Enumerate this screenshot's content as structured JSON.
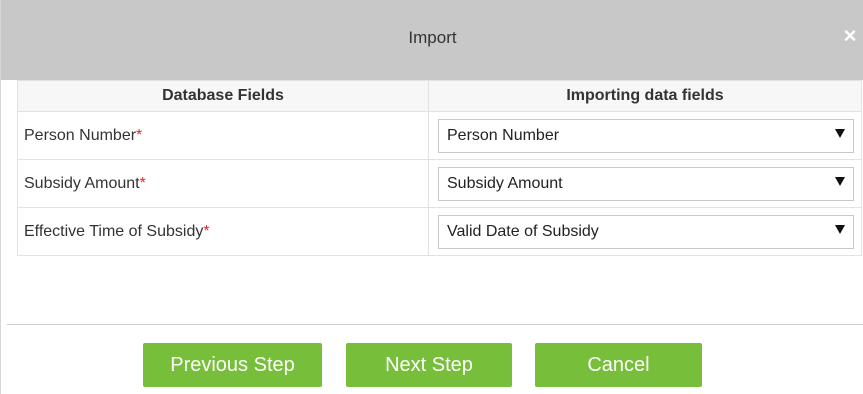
{
  "dialog": {
    "title": "Import",
    "close_symbol": "×"
  },
  "table": {
    "headers": [
      "Database Fields",
      "Importing data fields"
    ],
    "rows": [
      {
        "field": "Person Number",
        "required_mark": "*",
        "selected": "Person Number"
      },
      {
        "field": "Subsidy Amount",
        "required_mark": "*",
        "selected": "Subsidy Amount"
      },
      {
        "field": "Effective Time of Subsidy",
        "required_mark": "*",
        "selected": "Valid Date of Subsidy"
      }
    ]
  },
  "footer": {
    "previous_label": "Previous Step",
    "next_label": "Next Step",
    "cancel_label": "Cancel"
  },
  "colors": {
    "titlebar": "#c8c8c8",
    "button": "#77bf3a",
    "required": "#e0262d"
  },
  "icons": {
    "close": "close-icon",
    "dropdown": "caret-down-icon"
  }
}
